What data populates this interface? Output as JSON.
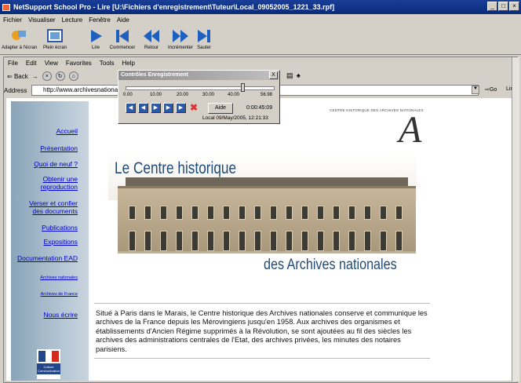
{
  "window": {
    "title": "NetSupport School Pro - Lire [U:\\Fichiers d'enregistrement\\Tuteur\\Local_09052005_1221_33.rpf]",
    "controls": [
      "_",
      "□",
      "×"
    ]
  },
  "menu": [
    "Fichier",
    "Visualiser",
    "Lecture",
    "Fenêtre",
    "Aide"
  ],
  "player_toolbar": [
    {
      "label": "Adapter à l'écran",
      "icon": "fit-screen-icon"
    },
    {
      "label": "Plein écran",
      "icon": "fullscreen-icon"
    },
    {
      "label": "Lire",
      "icon": "play-icon"
    },
    {
      "label": "Commencer",
      "icon": "skip-start-icon"
    },
    {
      "label": "Retour",
      "icon": "rewind-icon"
    },
    {
      "label": "Incrémenter",
      "icon": "fast-forward-icon"
    },
    {
      "label": "Sauter",
      "icon": "skip-end-icon"
    }
  ],
  "browser": {
    "menu": [
      "File",
      "Edit",
      "View",
      "Favorites",
      "Tools",
      "Help"
    ],
    "back_label": "Back",
    "address_label": "Address",
    "address_value": "http://www.archivesnationa",
    "go_label": "Go",
    "links_label": "Lin"
  },
  "player_dialog": {
    "title": "Contrôles Enregistrement",
    "close": "X",
    "ticks": [
      "0.00",
      "10.00",
      "20.00",
      "30.00",
      "40.00",
      "56.98"
    ],
    "aide_label": "Aide",
    "elapsed": "0:00:45:09",
    "source": "Local 09/May/2005, 12:21:33",
    "position_fraction": 0.79
  },
  "site": {
    "nav": [
      {
        "label": "Accueil",
        "size": "n"
      },
      {
        "label": "Présentation",
        "size": "n"
      },
      {
        "label": "Quoi de neuf ?",
        "size": "n"
      },
      {
        "label": "Obtenir une reproduction",
        "size": "n"
      },
      {
        "label": "Verser et confier des documents",
        "size": "n"
      },
      {
        "label": "Publications",
        "size": "n"
      },
      {
        "label": "Expositions",
        "size": "n"
      },
      {
        "label": "Documentation EAD",
        "size": "n"
      },
      {
        "label": "Archives nationales",
        "size": "s"
      },
      {
        "label": "Archives de France",
        "size": "s"
      },
      {
        "label": "Nous écrire",
        "size": "n"
      }
    ],
    "header_text": "CENTRE HISTORIQUE DES ARCHIVES NATIONALES",
    "logo_letter": "A",
    "banner_line1": "Le Centre historique",
    "banner_line2": "des Archives nationales",
    "paragraph": "Situé à Paris dans le Marais, le Centre historique des Archives nationales conserve et communique les archives de la France depuis les Mérovingiens jusqu'en 1958. Aux archives des organismes et établissements d'Ancien Régime supprimés à la Révolution, se sont ajoutées au fil des siècles les archives des administrations centrales de l'Etat, des archives privées, les minutes des notaires parisiens.",
    "ministry_text": "Culture Communication"
  },
  "colors": {
    "title_bar": "#0b2b7a",
    "link": "#0000cc",
    "banner_text": "#1f4a78",
    "button_blue": "#2c5aa8"
  }
}
